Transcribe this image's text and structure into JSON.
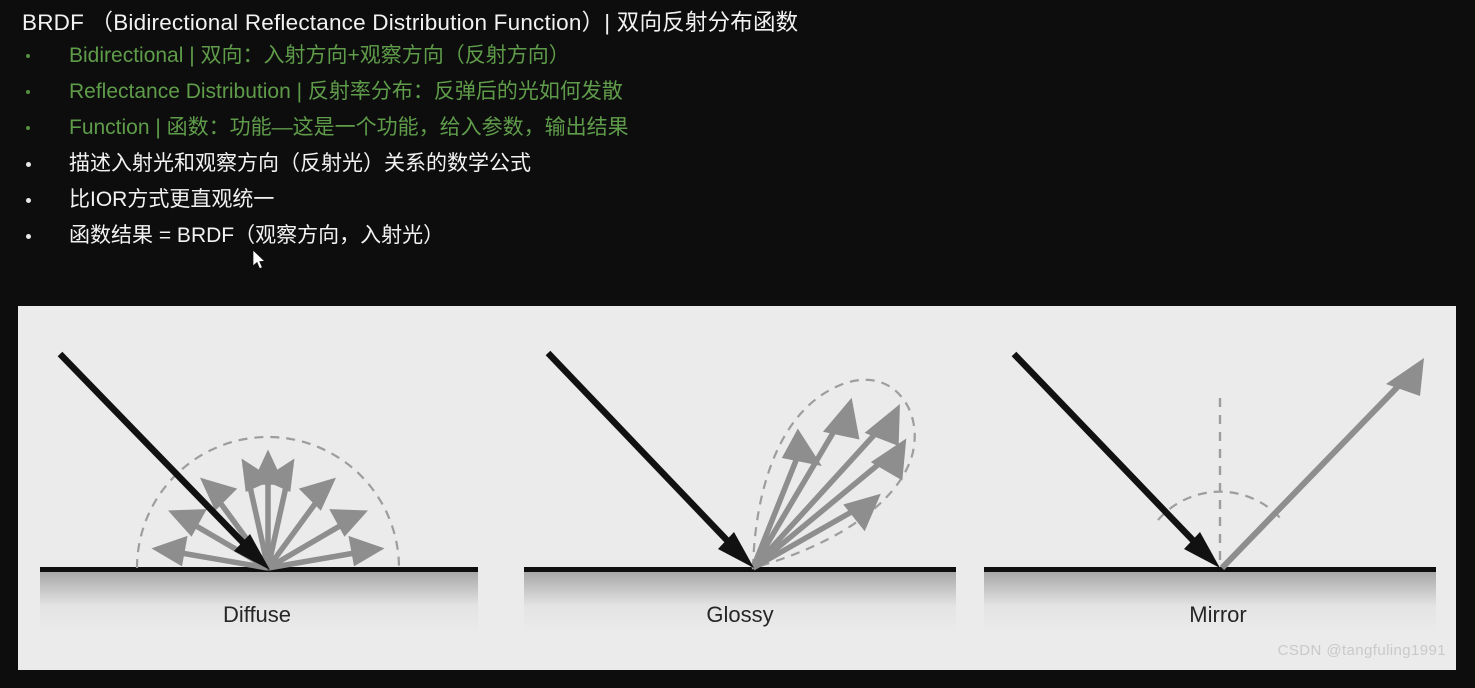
{
  "slide": {
    "title": "BRDF （Bidirectional Reflectance Distribution Function）| 双向反射分布函数",
    "bullets": [
      {
        "text": "Bidirectional | 双向：入射方向+观察方向（反射方向）",
        "accent": true
      },
      {
        "text": "Reflectance Distribution | 反射率分布：反弹后的光如何发散",
        "accent": true
      },
      {
        "text": "Function | 函数：功能—这是一个功能，给入参数，输出结果",
        "accent": true
      },
      {
        "text": "描述入射光和观察方向（反射光）关系的数学公式",
        "accent": false
      },
      {
        "text": "比IOR方式更直观统一",
        "accent": false
      },
      {
        "text": "函数结果 = BRDF（观察方向，入射光）",
        "accent": false
      }
    ]
  },
  "figure": {
    "panels": [
      {
        "id": "diffuse",
        "caption": "Diffuse",
        "type": "hemispherical-scatter",
        "ray_count": 9,
        "dashed_outline": "semicircle"
      },
      {
        "id": "glossy",
        "caption": "Glossy",
        "type": "specular-lobe",
        "ray_count": 5,
        "dashed_outline": "teardrop-lobe"
      },
      {
        "id": "mirror",
        "caption": "Mirror",
        "type": "mirror-reflection",
        "ray_count": 1,
        "dashed_outline": "normal-and-angle-arc"
      }
    ]
  },
  "watermark": "CSDN @tangfuling1991",
  "colors": {
    "background": "#0d0d0d",
    "text": "#f2f2f2",
    "accent_green": "#5f9c4a",
    "panel_background": "#ebebeb",
    "incident_ray": "#111111",
    "reflected_ray": "#8e8e8e",
    "dashed_guide": "#9a9a9a",
    "caption": "#262626",
    "watermark": "#c9c9c9"
  }
}
